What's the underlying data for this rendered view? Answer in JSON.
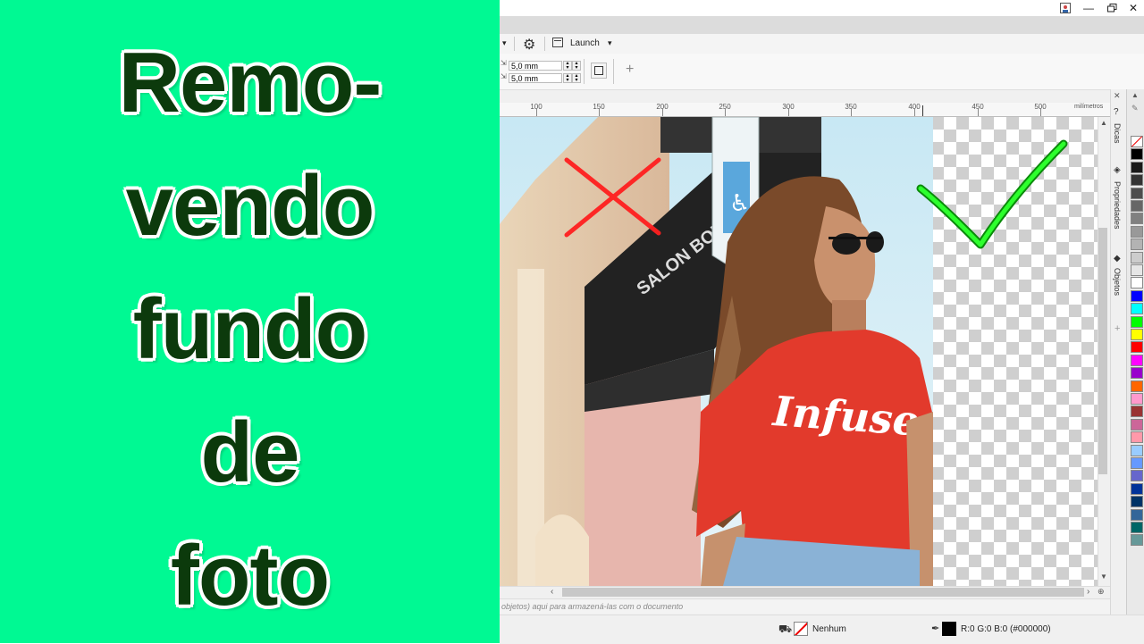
{
  "thumbnail": {
    "title_lines": [
      "Remo-",
      "vendo",
      "fundo",
      "de",
      "foto"
    ],
    "background_color": "#00f993",
    "text_color": "#0c3a0c"
  },
  "window": {
    "controls": [
      "photo-icon",
      "minimize-icon",
      "restore-icon",
      "close-icon"
    ]
  },
  "toolbar": {
    "launch_label": "Launch",
    "nudge_x": "5,0 mm",
    "nudge_y": "5,0 mm"
  },
  "ruler": {
    "ticks": [
      "100",
      "150",
      "200",
      "250",
      "300",
      "350",
      "400",
      "450",
      "500"
    ],
    "unit": "milímetros"
  },
  "dockers": {
    "tabs": [
      "Dicas",
      "Propriedades",
      "Objetos"
    ]
  },
  "palette": {
    "colors": [
      "#ffffff",
      "#000000",
      "#1a1a1a",
      "#333333",
      "#4d4d4d",
      "#666666",
      "#808080",
      "#999999",
      "#b3b3b3",
      "#cccccc",
      "#e6e6e6",
      "#ffffff",
      "#0000ff",
      "#00ffff",
      "#00ff00",
      "#ffff00",
      "#ff0000",
      "#ff00ff",
      "#9900cc",
      "#ff6600",
      "#ff99cc",
      "#993333",
      "#cc6699",
      "#ff99aa",
      "#99ccff",
      "#6699ff",
      "#6666cc",
      "#003399",
      "#003366",
      "#336699",
      "#006666",
      "#669999"
    ]
  },
  "canvas": {
    "shirt_text": "Infuse",
    "sign_text": "SALON BOUTIQ"
  },
  "docbar": {
    "hint": "objetos) aqui para armazená-las com o documento"
  },
  "status": {
    "fill_label": "Nenhum",
    "outline_color": "R:0 G:0 B:0 (#000000)"
  }
}
